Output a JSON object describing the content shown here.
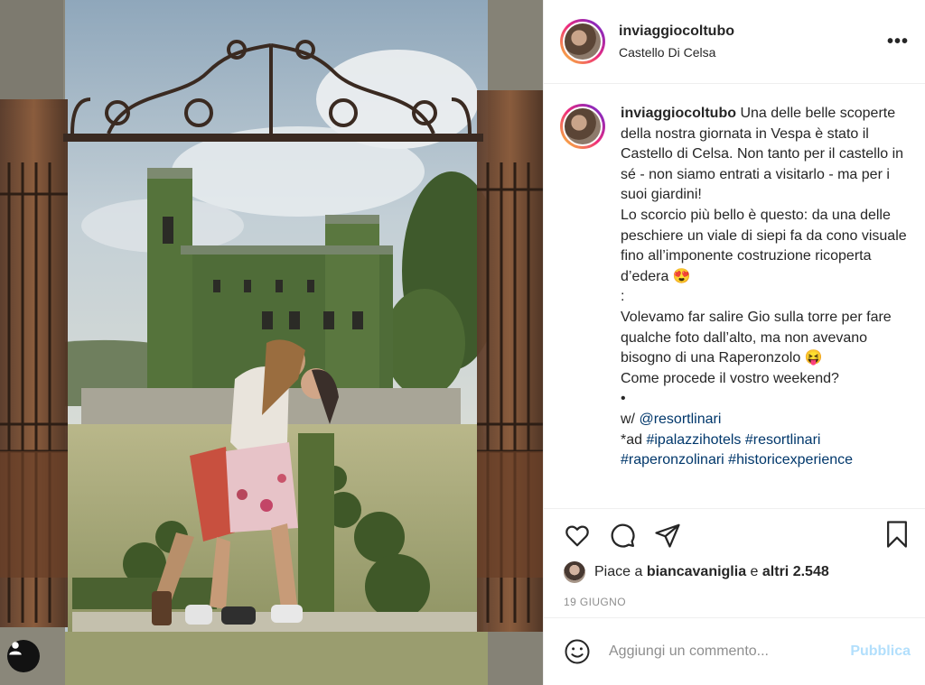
{
  "photo": {
    "alt": ""
  },
  "header": {
    "username": "inviaggiocoltubo",
    "location": "Castello Di Celsa",
    "more_icon": "more-options-icon"
  },
  "caption": {
    "username": "inviaggiocoltubo",
    "lines": [
      "Una delle belle scoperte della nostra giornata in Vespa è stato il Castello di Celsa. Non tanto per il castello in sé - non siamo entrati a visitarlo - ma per i suoi giardini!",
      "Lo scorcio più bello è questo: da una delle peschiere un viale di siepi fa da cono visuale fino all’imponente costruzione ricoperta d’edera 😍",
      ":",
      "Volevamo far salire Gio sulla torre per fare qualche foto dall’alto, ma non avevano bisogno di una Raperonzolo 😝",
      "Come procede il vostro weekend?",
      "•"
    ],
    "mention_prefix": "w/ ",
    "mention": "@resortlinari",
    "hashtags_prefix": "*ad ",
    "hashtags": "#ipalazzihotels #resortlinari",
    "hashtags_cut": "#raperonzolinari #historicexperience"
  },
  "actions": {
    "like_icon": "heart-icon",
    "comment_icon": "comment-icon",
    "share_icon": "share-icon",
    "save_icon": "bookmark-icon"
  },
  "likes": {
    "prefix": "Piace a ",
    "user": "biancavaniglia",
    "middle": " e ",
    "others": "altri 2.548"
  },
  "date": "19 GIUGNO",
  "comment": {
    "placeholder": "Aggiungi un commento...",
    "publish_label": "Pubblica",
    "emoji_icon": "emoji-icon"
  },
  "colors": {
    "link": "#00376b",
    "publish_disabled": "#b2dffc",
    "secondary_text": "#8e8e8e"
  }
}
